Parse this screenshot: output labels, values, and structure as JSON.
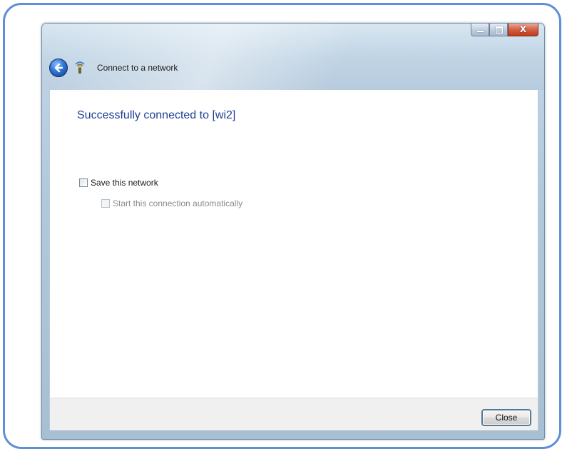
{
  "window": {
    "nav_title": "Connect to a network",
    "caption_close_symbol": "X"
  },
  "content": {
    "success_title": "Successfully connected to [wi2]",
    "save_network_label": "Save this network",
    "save_network_checked": false,
    "start_automatically_label": "Start this connection automatically",
    "start_automatically_checked": false,
    "start_automatically_enabled": false
  },
  "footer": {
    "close_label": "Close"
  },
  "icons": {
    "back": "back-arrow-icon",
    "network": "wireless-network-icon",
    "minimize": "minimize-icon",
    "maximize": "maximize-icon",
    "close": "close-icon"
  },
  "colors": {
    "frame_border": "#5f8fd6",
    "title_text": "#1e3f94",
    "close_caption": "#c23a1c"
  }
}
